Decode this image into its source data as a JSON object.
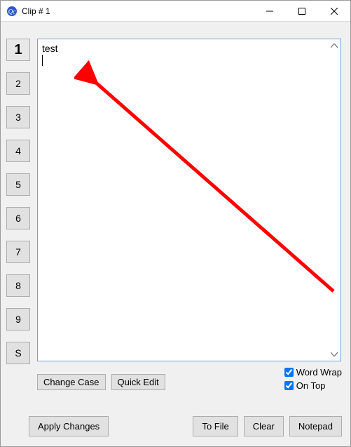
{
  "window": {
    "title": "Clip # 1"
  },
  "clips": {
    "active_index": 0,
    "buttons": [
      "1",
      "2",
      "3",
      "4",
      "5",
      "6",
      "7",
      "8",
      "9",
      "S"
    ]
  },
  "editor": {
    "text": "test"
  },
  "mid_buttons": {
    "change_case": "Change Case",
    "quick_edit": "Quick Edit"
  },
  "checkboxes": {
    "word_wrap_label": "Word Wrap",
    "word_wrap_checked": true,
    "on_top_label": "On Top",
    "on_top_checked": true
  },
  "bottom_buttons": {
    "apply_changes": "Apply Changes",
    "to_file": "To File",
    "clear": "Clear",
    "notepad": "Notepad"
  },
  "annotation": {
    "arrow_color": "#ff0000"
  }
}
